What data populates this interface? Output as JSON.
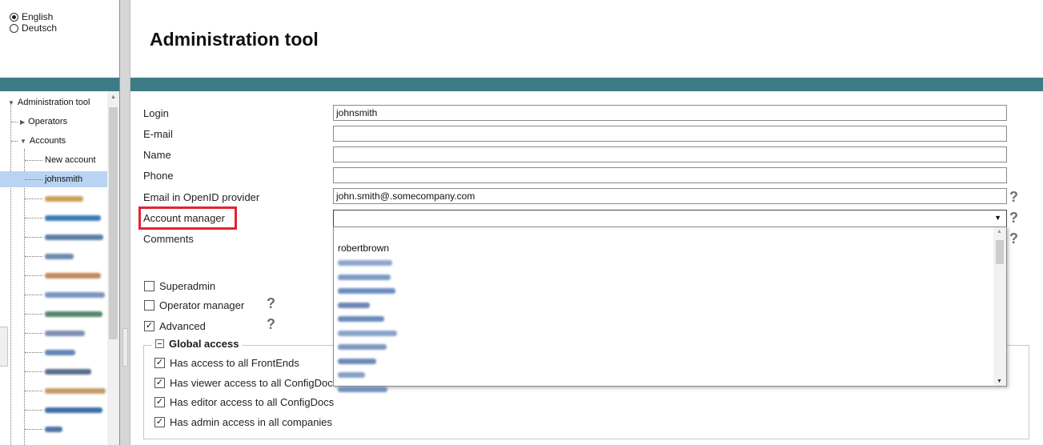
{
  "language": {
    "options": [
      {
        "label": "English",
        "selected": true
      },
      {
        "label": "Deutsch",
        "selected": false
      }
    ]
  },
  "tree": {
    "root": "Administration tool",
    "operators": "Operators",
    "accounts": "Accounts",
    "new_account": "New account",
    "selected_account": "johnsmith",
    "blurred_colors": [
      "#c9a25a",
      "#3d7ab8",
      "#5a7fa8",
      "#6d8ab0",
      "#c38a5e",
      "#7a95be",
      "#56866a",
      "#7d8fb3",
      "#5f86b5",
      "#5a6f8c",
      "#c79b6b",
      "#3d6fa8",
      "#4f74a4"
    ]
  },
  "header": {
    "title": "Administration tool"
  },
  "form": {
    "login_label": "Login",
    "login_value": "johnsmith",
    "email_label": "E-mail",
    "email_value": "",
    "name_label": "Name",
    "name_value": "",
    "phone_label": "Phone",
    "phone_value": "",
    "openid_label": "Email in OpenID provider",
    "openid_value": "john.smith@.somecompany.com",
    "account_manager_label": "Account manager",
    "comments_label": "Comments",
    "help_symbol": "?"
  },
  "dropdown": {
    "options": [
      "robertbrown"
    ],
    "blurred_option_count": 10,
    "blurred_colors": [
      "#8ea6cc",
      "#7e9bc4",
      "#6a8ec0",
      "#6f86b2",
      "#6b8bb9",
      "#8aa2c9",
      "#7f97bf",
      "#6e8ab6",
      "#86a0c7",
      "#7491bd"
    ]
  },
  "checkboxes": [
    {
      "label": "Superadmin",
      "checked": false
    },
    {
      "label": "Operator manager",
      "checked": false
    },
    {
      "label": "Advanced",
      "checked": true
    }
  ],
  "global_access": {
    "title": "Global access",
    "items": [
      {
        "label": "Has access to all FrontEnds",
        "checked": true
      },
      {
        "label": "Has viewer access to all ConfigDocs",
        "checked": true
      },
      {
        "label": "Has editor access to all ConfigDocs",
        "checked": true
      },
      {
        "label": "Has admin access in all companies",
        "checked": true
      }
    ]
  },
  "colors": {
    "band": "#3c7c86",
    "highlight": "#e22330",
    "selected_row": "#b9d4f2"
  }
}
